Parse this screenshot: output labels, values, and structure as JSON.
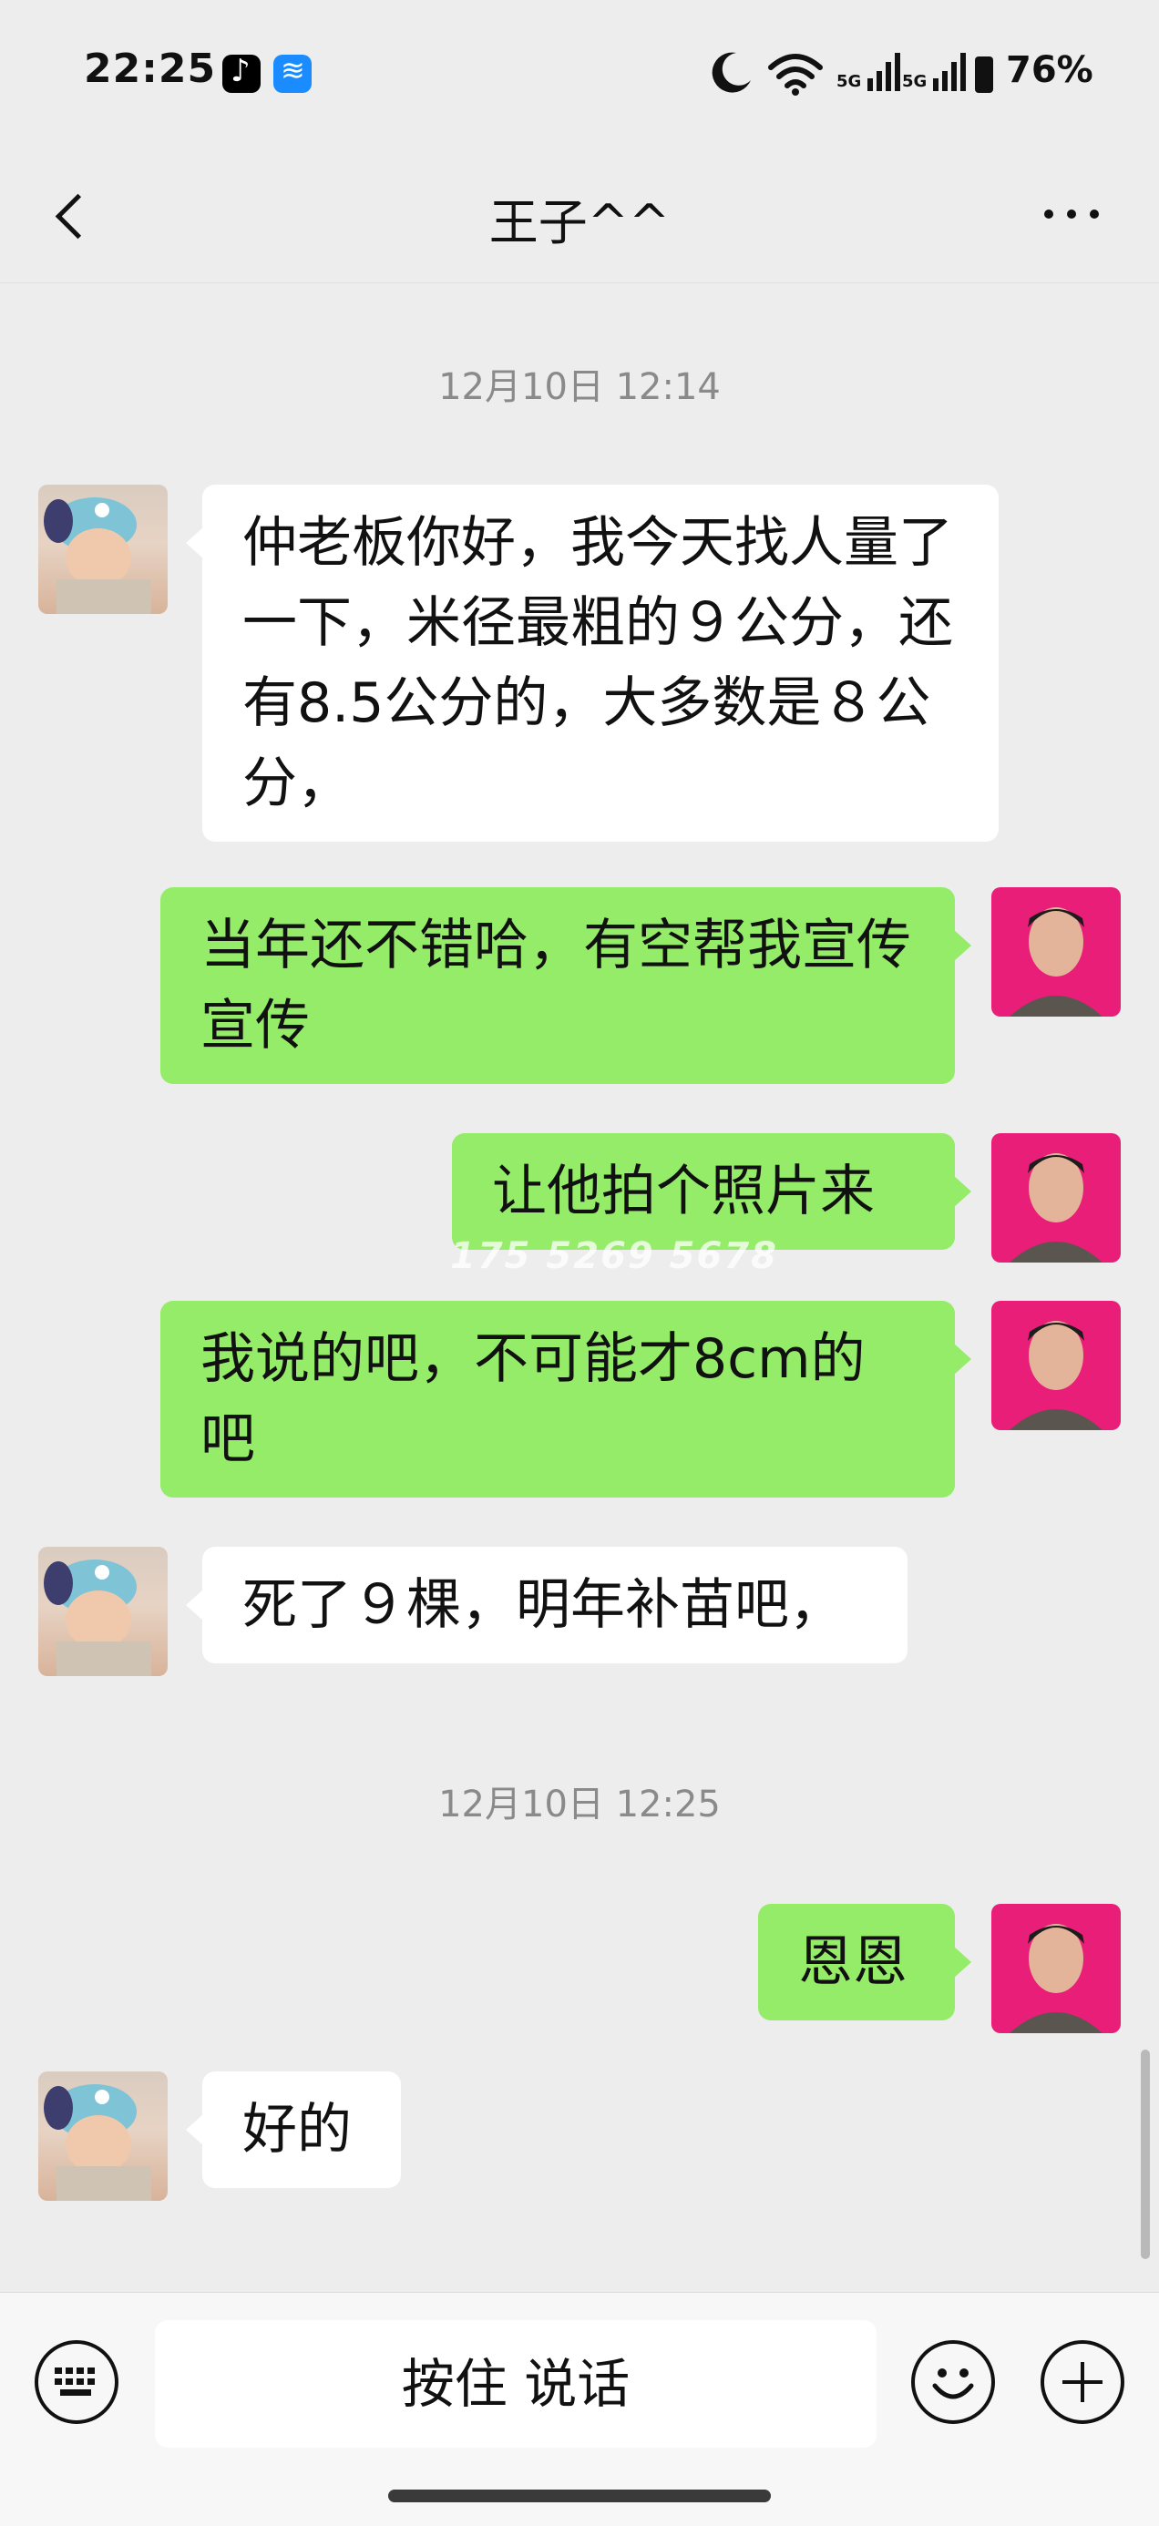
{
  "status_bar": {
    "time": "22:25",
    "signal1": "5G",
    "signal2": "5G",
    "battery": "76%"
  },
  "header": {
    "title": "王子^^"
  },
  "messages": {
    "ts1": "12月10日 12:14",
    "m1": "仲老板你好，我今天找人量了一下，米径最粗的９公分，还有8.5公分的，大多数是８公分，",
    "m2": "当年还不错哈，有空帮我宣传宣传",
    "m3": "让他拍个照片来",
    "m4": "我说的吧，不可能才8cm的吧",
    "m5": "死了９棵，明年补苗吧，",
    "ts2": "12月10日 12:25",
    "m6": "恩恩",
    "m7": "好的"
  },
  "watermark": "175  5269  5678",
  "input_bar": {
    "hold_to_talk": "按住 说话"
  }
}
